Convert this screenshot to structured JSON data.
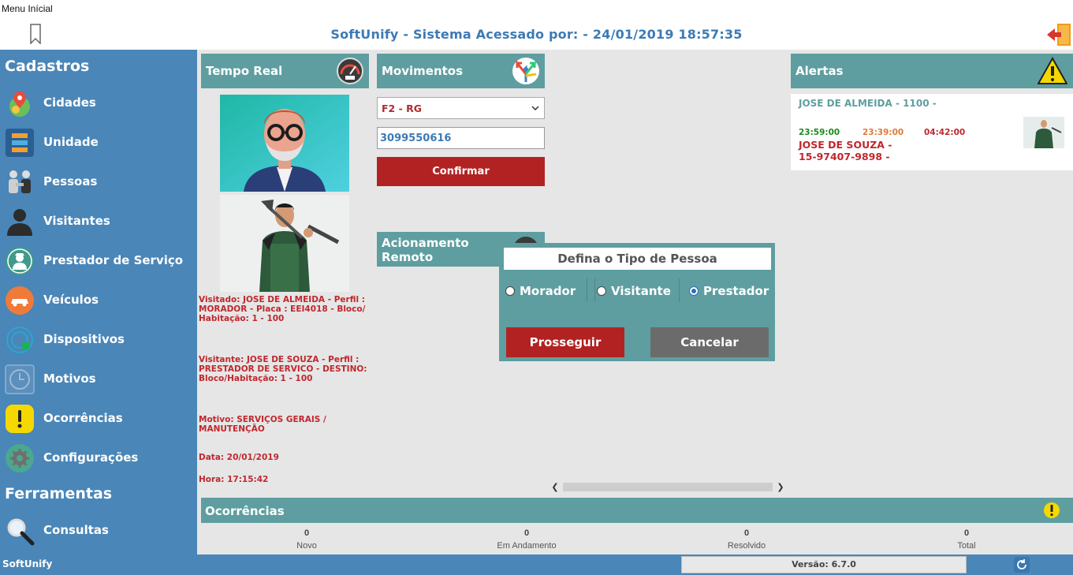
{
  "window": {
    "title": "Menu Inícial"
  },
  "header": {
    "title": "SoftUnify - Sistema Acessado por:  -  24/01/2019 18:57:35"
  },
  "sidebar": {
    "section_cadastros": "Cadastros",
    "items": [
      {
        "label": "Cidades",
        "icon": "map-pin-icon"
      },
      {
        "label": "Unidade",
        "icon": "building-icon"
      },
      {
        "label": "Pessoas",
        "icon": "people-icon"
      },
      {
        "label": "Visitantes",
        "icon": "visitor-icon"
      },
      {
        "label": "Prestador de Serviço",
        "icon": "worker-icon"
      },
      {
        "label": "Veículos",
        "icon": "car-icon"
      },
      {
        "label": "Dispositivos",
        "icon": "device-icon"
      },
      {
        "label": "Motivos",
        "icon": "clock-icon"
      },
      {
        "label": "Ocorrências",
        "icon": "warning-icon"
      },
      {
        "label": "Configurações",
        "icon": "gear-icon"
      }
    ],
    "section_ferramentas": "Ferramentas",
    "tools": [
      {
        "label": "Consultas",
        "icon": "magnifier-icon"
      }
    ]
  },
  "realtime": {
    "title": "Tempo Real",
    "visitado": "Visitado: JOSE DE ALMEIDA  - Perfil : MORADOR - Placa : EEI4018 - Bloco/ Habitação: 1 - 100",
    "visitante": "Visitante: JOSE DE SOUZA - Perfil : PRESTADOR DE SERVICO - DESTINO: Bloco/Habitação: 1 - 100",
    "motivo": "Motivo: SERVIÇOS GERAIS / MANUTENÇÃO",
    "data": "Data: 20/01/2019",
    "hora": "Hora: 17:15:42"
  },
  "movimentos": {
    "title": "Movimentos",
    "select_value": "F2 - RG",
    "document_value": "3099550616",
    "confirm_label": "Confirmar"
  },
  "acionamento": {
    "title": "Acionamento Remoto"
  },
  "alertas": {
    "title": "Alertas",
    "resident": "JOSE DE ALMEIDA  - 1100 -",
    "time1": "23:59:00",
    "time2": "23:39:00",
    "time3": "04:42:00",
    "visitor_name": "JOSE DE SOUZA -",
    "visitor_doc": "15-97407-9898 -",
    "colors": {
      "time1": "#1e8a1e",
      "time2": "#e07b39",
      "time3": "#c0272d"
    }
  },
  "modal": {
    "title": "Defina o Tipo de Pessoa",
    "options": [
      {
        "label": "Morador",
        "selected": false
      },
      {
        "label": "Visitante",
        "selected": false
      },
      {
        "label": "Prestador",
        "selected": true
      }
    ],
    "proceed_label": "Prosseguir",
    "cancel_label": "Cancelar"
  },
  "ocorrencias": {
    "title": "Ocorrências",
    "stats": [
      {
        "value": "0",
        "label": "Novo"
      },
      {
        "value": "0",
        "label": "Em Andamento"
      },
      {
        "value": "0",
        "label": "Resolvido"
      },
      {
        "value": "0",
        "label": "Total"
      }
    ]
  },
  "statusbar": {
    "brand": "SoftUnify",
    "version": "Versão: 6.7.0"
  },
  "colors": {
    "sidebar": "#4a86b8",
    "panel": "#5f9ea0",
    "accent_red": "#b22222",
    "title_blue": "#3d7ab5"
  }
}
